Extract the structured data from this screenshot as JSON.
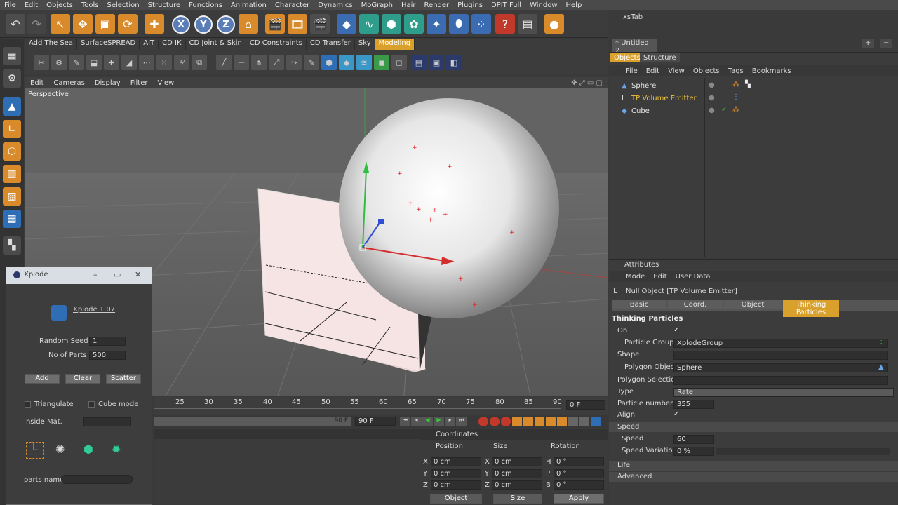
{
  "menubar": [
    "File",
    "Edit",
    "Objects",
    "Tools",
    "Selection",
    "Structure",
    "Functions",
    "Animation",
    "Character",
    "Dynamics",
    "MoGraph",
    "Hair",
    "Render",
    "Plugins",
    "DPIT Full",
    "Window",
    "Help"
  ],
  "plugin_tabs": [
    "Add The Sea",
    "SurfaceSPREAD",
    "AIT",
    "CD IK",
    "CD Joint & Skin",
    "CD Constraints",
    "CD Transfer",
    "Sky",
    "Modeling"
  ],
  "viewport": {
    "menu": [
      "Edit",
      "Cameras",
      "Display",
      "Filter",
      "View"
    ],
    "label": "Perspective"
  },
  "axis_buttons": [
    "X",
    "Y",
    "Z"
  ],
  "timeline": {
    "ticks": [
      "25",
      "30",
      "35",
      "40",
      "45",
      "50",
      "55",
      "60",
      "65",
      "70",
      "75",
      "80",
      "85",
      "90"
    ],
    "frame_field": "0 F",
    "end_field_a": "90 F",
    "end_field_b": "90 F"
  },
  "coordinates": {
    "title": "Coordinates",
    "headers": [
      "Position",
      "Size",
      "Rotation"
    ],
    "rows": [
      {
        "a": "X",
        "pos": "0 cm",
        "b": "X",
        "size": "0 cm",
        "c": "H",
        "rot": "0 °"
      },
      {
        "a": "Y",
        "pos": "0 cm",
        "b": "Y",
        "size": "0 cm",
        "c": "P",
        "rot": "0 °"
      },
      {
        "a": "Z",
        "pos": "0 cm",
        "b": "Z",
        "size": "0 cm",
        "c": "B",
        "rot": "0 °"
      }
    ],
    "mode_object": "Object",
    "mode_size": "Size",
    "apply": "Apply"
  },
  "right": {
    "xstab": "xsTab",
    "doc_tab": "* Untitled 2",
    "obj_tabs": [
      "Objects",
      "Structure"
    ],
    "obj_menu": [
      "File",
      "Edit",
      "View",
      "Objects",
      "Tags",
      "Bookmarks"
    ],
    "objects": [
      {
        "name": "Sphere",
        "color": "#e6e6e6"
      },
      {
        "name": "TP Volume Emitter",
        "color": "#f0c23a"
      },
      {
        "name": "Cube",
        "color": "#e6e6e6"
      }
    ]
  },
  "attributes": {
    "title": "Attributes",
    "menu": [
      "Mode",
      "Edit",
      "User Data"
    ],
    "object_line": "Null Object [TP Volume Emitter]",
    "tabs": [
      "Basic",
      "Coord.",
      "Object",
      "Thinking Particles"
    ],
    "section": "Thinking Particles",
    "on_label": "On",
    "particle_group_label": "Particle Group",
    "particle_group": "XplodeGroup",
    "shape_label": "Shape",
    "polygon_object_label": "Polygon Object",
    "polygon_object": "Sphere",
    "polygon_selection_label": "Polygon Selection",
    "type_label": "Type",
    "type": "Rate",
    "particle_number_label": "Particle number",
    "particle_number": "355",
    "align_label": "Align",
    "speed_section": "Speed",
    "speed_label": "Speed",
    "speed": "60",
    "speed_variation_label": "Speed Variation",
    "speed_variation": "0 %",
    "life_section": "Life",
    "advanced_section": "Advanced"
  },
  "xplode": {
    "window_title": "Xplode",
    "version": "Xplode 1.07",
    "random_seed_label": "Random Seed",
    "random_seed": "1",
    "no_parts_label": "No of Parts",
    "no_parts": "500",
    "add": "Add",
    "clear": "Clear",
    "scatter": "Scatter",
    "triangulate": "Triangulate",
    "cube_mode": "Cube mode",
    "inside_mat": "Inside Mat.",
    "parts_name": "parts name"
  },
  "colors": {
    "accent": "#d9a12c",
    "viewport_bg": "#5f5f5f",
    "y_axis": "#2fbf3f",
    "x_axis": "#d32f2f",
    "z_axis": "#2f4fd3"
  }
}
